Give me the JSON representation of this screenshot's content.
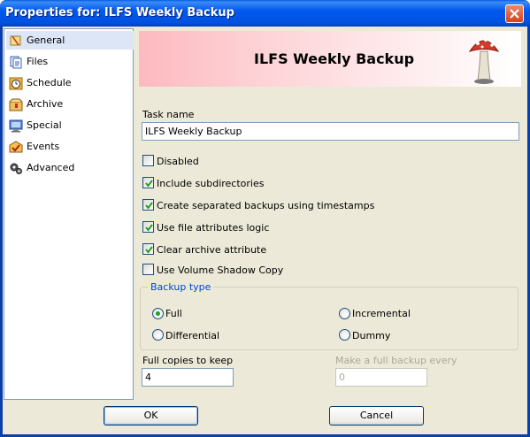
{
  "window": {
    "title": "Properties for: ILFS Weekly Backup"
  },
  "colors": {
    "title_bar": "#0058ee",
    "accent_group_title": "#0046d5",
    "banner_pink": "#fdb9bf"
  },
  "sidebar": {
    "items": [
      {
        "label": "General",
        "icon": "general-icon",
        "selected": true
      },
      {
        "label": "Files",
        "icon": "files-icon",
        "selected": false
      },
      {
        "label": "Schedule",
        "icon": "schedule-icon",
        "selected": false
      },
      {
        "label": "Archive",
        "icon": "archive-icon",
        "selected": false
      },
      {
        "label": "Special",
        "icon": "special-icon",
        "selected": false
      },
      {
        "label": "Events",
        "icon": "events-icon",
        "selected": false
      },
      {
        "label": "Advanced",
        "icon": "advanced-icon",
        "selected": false
      }
    ]
  },
  "banner": {
    "title": "ILFS Weekly Backup",
    "icon": "mushroom-icon"
  },
  "form": {
    "task_name_label": "Task name",
    "task_name_value": "ILFS Weekly Backup",
    "options": [
      {
        "label": "Disabled",
        "checked": false
      },
      {
        "label": "Include subdirectories",
        "checked": true
      },
      {
        "label": "Create separated backups using timestamps",
        "checked": true
      },
      {
        "label": "Use file attributes logic",
        "checked": true
      },
      {
        "label": "Clear archive attribute",
        "checked": true
      },
      {
        "label": "Use Volume Shadow Copy",
        "checked": false
      }
    ],
    "backup_type": {
      "title": "Backup type",
      "options": [
        {
          "label": "Full",
          "selected": true
        },
        {
          "label": "Incremental",
          "selected": false
        },
        {
          "label": "Differential",
          "selected": false
        },
        {
          "label": "Dummy",
          "selected": false
        }
      ]
    },
    "full_copies_label": "Full copies to keep",
    "full_copies_value": "4",
    "full_backup_every_label": "Make a full backup every",
    "full_backup_every_value": "0"
  },
  "buttons": {
    "ok": "OK",
    "cancel": "Cancel"
  }
}
